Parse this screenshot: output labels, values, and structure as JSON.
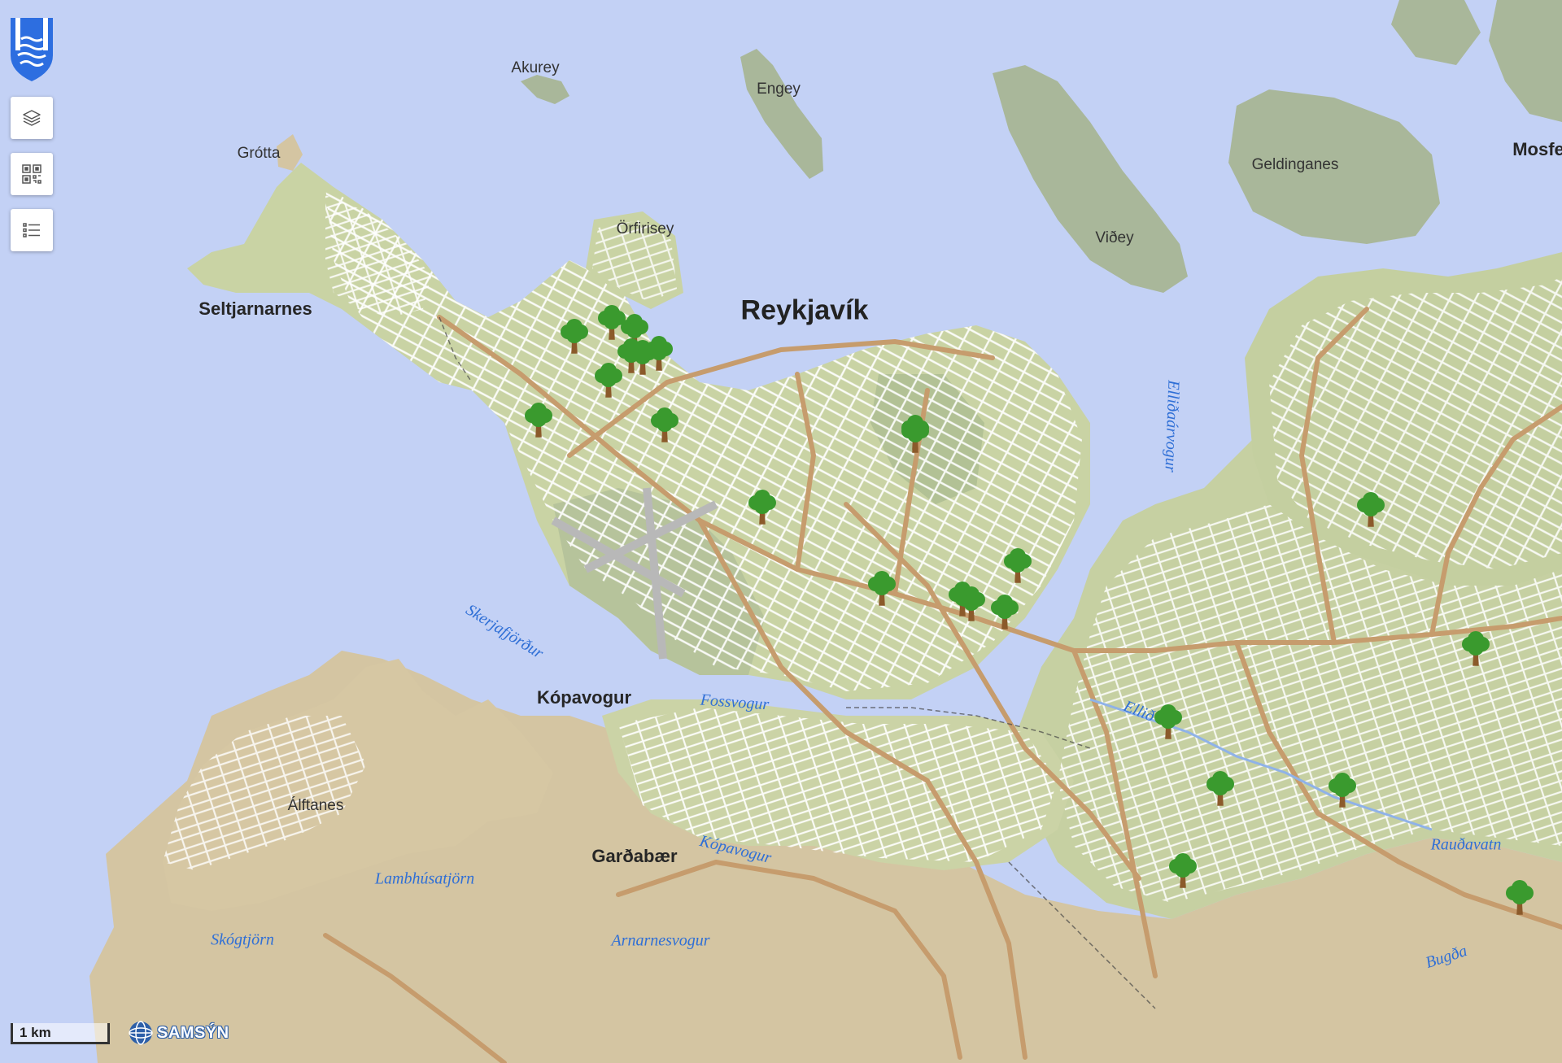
{
  "map": {
    "title": "Reykjavík",
    "towns": [
      "Seltjarnarnes",
      "Kópavogur",
      "Garðabær",
      "Mosfe"
    ],
    "places": [
      "Akurey",
      "Engey",
      "Grótta",
      "Örfirisey",
      "Viðey",
      "Geldinganes",
      "Álftanes"
    ],
    "waters": [
      "Skerjafjörður",
      "Fossvogur",
      "Elliðaárvogur",
      "Ellið",
      "Kópavogur",
      "Lambhúsatjörn",
      "Skógtjörn",
      "Arnarnesvogur",
      "Rauðavatn",
      "Bugða"
    ],
    "colors": {
      "sea": "#c3d1f5",
      "urban": "#c9d3a4",
      "rural": "#d6c7a1",
      "hill": "#a9b79a",
      "road": "#c69c6d",
      "street": "#ffffff",
      "tree_leaf": "#3a9a2e",
      "tree_trunk": "#8b5a2b"
    },
    "tree_markers": 24,
    "tree_icon": "tree-icon"
  },
  "controls": {
    "logo_icon": "reykjavik-coat-of-arms-icon",
    "layers_icon": "layers-icon",
    "qr_icon": "qr-code-icon",
    "legend_icon": "list-icon"
  },
  "scale_bar": {
    "label": "1 km"
  },
  "attribution": {
    "label": "SAMSÝN"
  }
}
